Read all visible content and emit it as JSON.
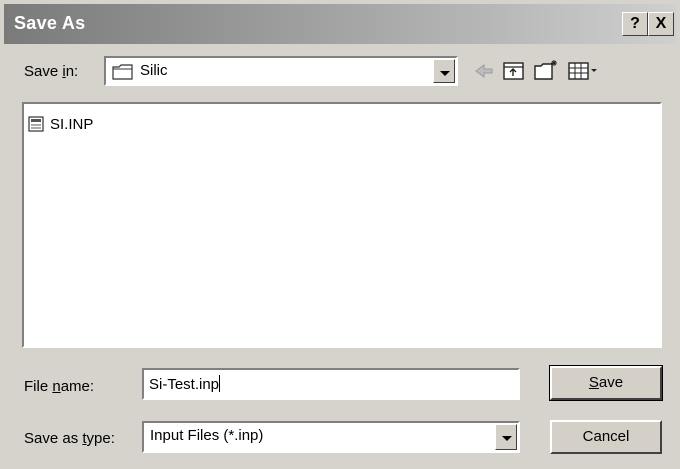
{
  "window": {
    "title": "Save As",
    "help_label": "?",
    "close_label": "X"
  },
  "save_in": {
    "label_pre": "Save ",
    "label_key": "i",
    "label_post": "n:",
    "value": "Silic"
  },
  "toolbar": {
    "icons": [
      "back-icon",
      "up-folder-icon",
      "new-folder-icon",
      "view-menu-icon"
    ]
  },
  "files": [
    {
      "name": "SI.INP",
      "icon": "document-icon"
    }
  ],
  "file_name": {
    "label_pre": "File ",
    "label_key": "n",
    "label_post": "ame:",
    "value": "Si-Test.inp"
  },
  "save_as_type": {
    "label_pre": "Save as ",
    "label_key": "t",
    "label_post": "ype:",
    "value": "Input Files (*.inp)"
  },
  "buttons": {
    "save_key": "S",
    "save_rest": "ave",
    "cancel": "Cancel"
  }
}
